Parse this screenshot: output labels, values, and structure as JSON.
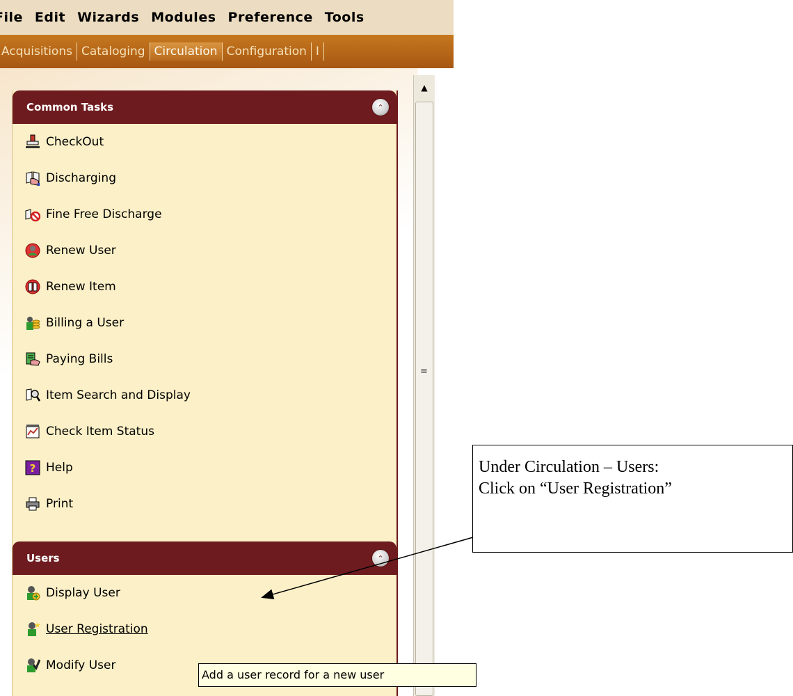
{
  "menubar": {
    "items": [
      "File",
      "Edit",
      "Wizards",
      "Modules",
      "Preference",
      "Tools"
    ]
  },
  "tabs": [
    {
      "label": "Acquisitions",
      "active": false
    },
    {
      "label": "Cataloging",
      "active": false
    },
    {
      "label": "Circulation",
      "active": true
    },
    {
      "label": "Configuration",
      "active": false
    },
    {
      "label": "I",
      "active": false
    }
  ],
  "common_tasks": {
    "title": "Common Tasks",
    "items": [
      {
        "label": "CheckOut",
        "icon": "stamp-icon"
      },
      {
        "label": "Discharging",
        "icon": "discharge-book-icon"
      },
      {
        "label": "Fine Free Discharge",
        "icon": "fine-free-icon"
      },
      {
        "label": "Renew User",
        "icon": "renew-user-icon"
      },
      {
        "label": "Renew Item",
        "icon": "renew-item-icon"
      },
      {
        "label": "Billing a User",
        "icon": "billing-icon"
      },
      {
        "label": "Paying Bills",
        "icon": "paying-bills-icon"
      },
      {
        "label": "Item Search and Display",
        "icon": "item-search-icon"
      },
      {
        "label": "Check Item Status",
        "icon": "item-status-icon"
      },
      {
        "label": "Help",
        "icon": "help-icon"
      },
      {
        "label": "Print",
        "icon": "printer-icon"
      }
    ]
  },
  "users": {
    "title": "Users",
    "items": [
      {
        "label": "Display User",
        "icon": "display-user-icon"
      },
      {
        "label": "User Registration",
        "icon": "user-registration-icon"
      },
      {
        "label": "Modify User",
        "icon": "modify-user-icon"
      }
    ]
  },
  "tooltip": "Add a user record for a new user",
  "callout": {
    "line1": "Under Circulation – Users:",
    "line2": "Click on “User Registration”"
  },
  "colors": {
    "panel_header": "#6e1b1f",
    "panel_body": "#fbf0c7",
    "tab_bar": "#b8661a",
    "menubar": "#ecdcc1"
  }
}
